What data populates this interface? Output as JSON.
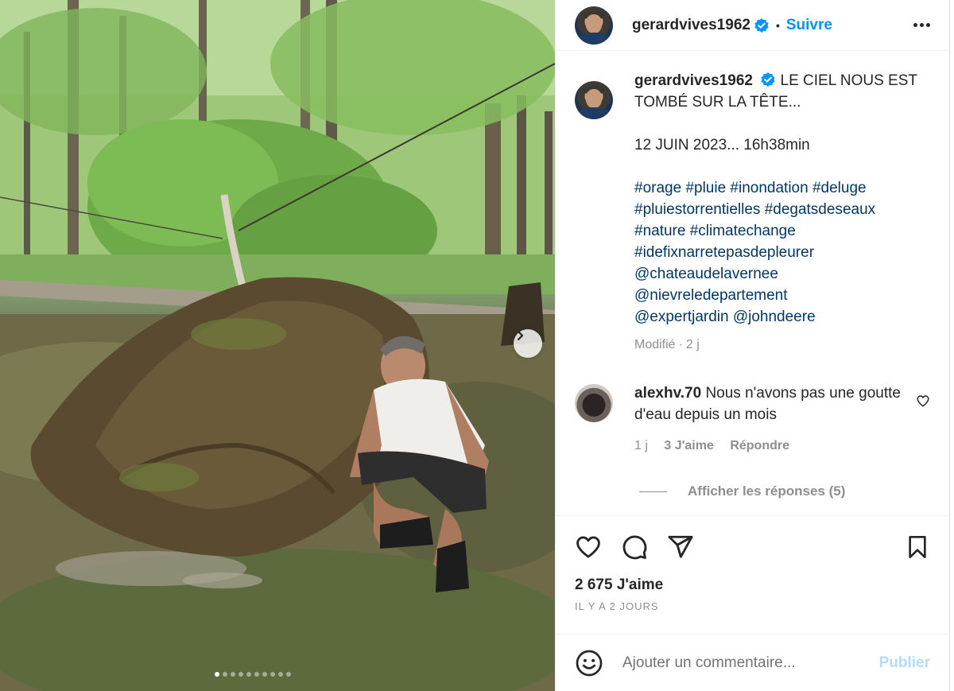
{
  "post": {
    "username": "gerardvives1962",
    "follow_label": "Suivre",
    "separator": "•"
  },
  "caption": {
    "username": "gerardvives1962",
    "line1": "LE CIEL NOUS EST TOMBÉ SUR LA TÊTE...",
    "line2": "12 JUIN 2023... 16h38min",
    "tags": [
      "#orage #pluie #inondation #deluge",
      "#pluiestorrentielles #degatsdeseaux",
      "#nature #climatechange",
      "#idefixnarretepasdepleurer",
      "@chateaudelavernee",
      "@nievreledepartement",
      "@expertjardin @johndeere"
    ],
    "edited": "Modifié",
    "dot": "·",
    "age": "2 j"
  },
  "comment": {
    "username": "alexhv.70",
    "text": "Nous n'avons pas une goutte d'eau depuis un mois",
    "time": "1 j",
    "likes": "3 J'aime",
    "reply": "Répondre",
    "view_replies": "Afficher les réponses (5)"
  },
  "stats": {
    "likes": "2 675 J'aime",
    "date": "IL Y A 2 JOURS"
  },
  "composer": {
    "placeholder": "Ajouter un commentaire...",
    "publish": "Publier"
  },
  "carousel": {
    "slide_count": 10,
    "active_index": 0
  },
  "colors": {
    "link": "#0095f6",
    "hashtag": "#00376b",
    "muted": "#8e8e8e",
    "publish_disabled": "#b3dbff"
  },
  "icons": [
    "verified-badge-icon",
    "more-icon",
    "heart-icon",
    "comment-icon",
    "share-icon",
    "bookmark-icon",
    "emoji-icon",
    "chevron-right-icon"
  ]
}
